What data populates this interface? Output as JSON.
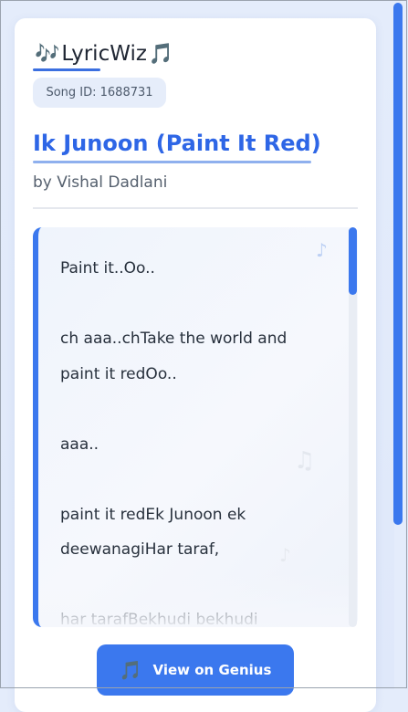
{
  "app": {
    "brand": "LyricWiz",
    "brand_icon_left": "🎶",
    "brand_icon_right": "🎵"
  },
  "song": {
    "id_label": "Song ID: 1688731",
    "title": "Ik Junoon (Paint It Red)",
    "artist": "by Vishal Dadlani"
  },
  "lyrics": {
    "lines": [
      "Paint it..Oo..",
      "",
      "ch aaa..chTake the world and",
      "paint it redOo..",
      "",
      "aaa..",
      "",
      "paint it redEk Junoon ek",
      "deewanagiHar taraf,",
      "",
      "har tarafBekhudi bekhudi"
    ]
  },
  "actions": {
    "genius_button_label": "View on Genius",
    "genius_icon": "🎵"
  },
  "colors": {
    "accent": "#3b78ee",
    "title": "#2e66e6"
  }
}
